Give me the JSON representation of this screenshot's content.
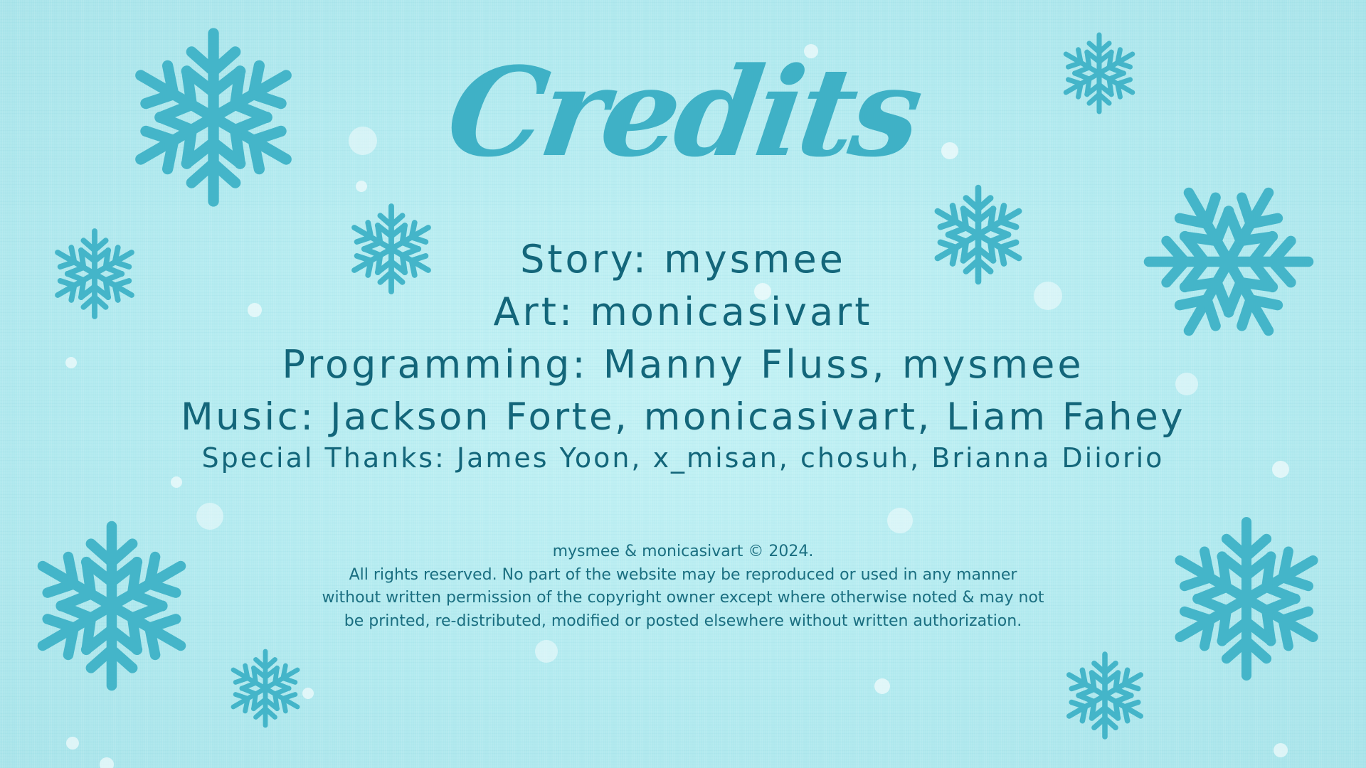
{
  "title": "Credits",
  "credits": {
    "story": "Story: mysmee",
    "art": "Art: monicasivart",
    "programming": "Programming: Manny Fluss, mysmee",
    "music": "Music: Jackson Forte, monicasivart, Liam Fahey",
    "special_thanks": "Special Thanks: James Yoon, x_misan, chosuh, Brianna Diiorio"
  },
  "copyright": {
    "line1": "mysmee & monicasivart © 2024.",
    "line2": "All rights reserved. No part of the website may be reproduced or used in any manner",
    "line3": "without written permission of the copyright owner except where otherwise noted & may not",
    "line4": "be printed, re-distributed, modified or posted elsewhere without written authorization."
  },
  "colors": {
    "background": "#b3ecf0",
    "snowflake": "#44b5c9",
    "title": "#3fb1c6",
    "credit_text": "#13667a"
  },
  "icons": [
    "snowflake-icon",
    "snow-dot"
  ]
}
